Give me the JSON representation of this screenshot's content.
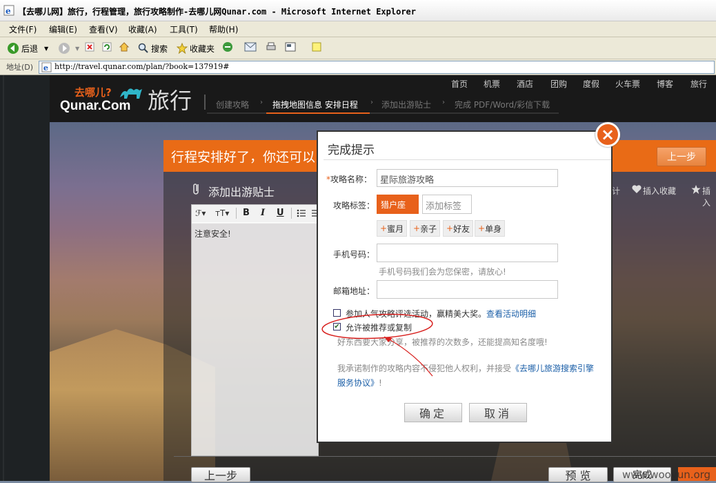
{
  "window": {
    "title": "【去哪儿网】旅行，行程管理，旅行攻略制作-去哪儿网Qunar.com - Microsoft Internet Explorer"
  },
  "menu": [
    "文件(F)",
    "编辑(E)",
    "查看(V)",
    "收藏(A)",
    "工具(T)",
    "帮助(H)"
  ],
  "toolbar": {
    "back": "后退",
    "search": "搜索",
    "favorites": "收藏夹"
  },
  "address": {
    "label": "地址(D)",
    "url": "http://travel.qunar.com/plan/?book=137919#"
  },
  "site": {
    "logo_top": "去哪儿?",
    "logo_bottom": "Qunar.Com",
    "section": "旅行",
    "nav": [
      "首页",
      "机票",
      "酒店",
      "团购",
      "度假",
      "火车票",
      "博客",
      "旅行"
    ],
    "steps": [
      "创建攻略",
      "拖拽地图信息 安排日程",
      "添加出游贴士",
      "完成 PDF/Word/彩信下载"
    ]
  },
  "page": {
    "banner": "行程安排好了，你还可以",
    "prev_top": "上一步",
    "tips_title": "添加出游贴士",
    "action_insert_fav": "插入收藏",
    "action_insert": "插入",
    "editor_text": "注意安全!",
    "bottom_prev": "上一步",
    "bottom_preview": "预 览",
    "bottom_done": "完成",
    "watermark": "www.wooyun.org"
  },
  "dialog": {
    "title": "完成提示",
    "name_label": "攻略名称：",
    "name_value": "星际旅游攻略",
    "tag_label": "攻略标签：",
    "tag_selected": "猎户座",
    "tag_placeholder": "添加标签",
    "suggested_tags": [
      "蜜月",
      "亲子",
      "好友",
      "单身"
    ],
    "phone_label": "手机号码：",
    "phone_hint": "手机号码我们会为您保密，请放心!",
    "email_label": "邮箱地址：",
    "contest_text": "参加人气攻略评选活动，赢精美大奖。",
    "contest_link": "查看活动明细",
    "allow_text": "允许被推荐或复制",
    "allow_hint": "好东西要大家分享，被推荐的次数多，还能提高知名度哦!",
    "promise_text": "我承诺制作的攻略内容不侵犯他人权利，并接受",
    "promise_link": "《去哪儿旅游搜索引擎服务协议》",
    "promise_end": "!",
    "ok_label": "确定",
    "cancel_label": "取消"
  },
  "colors": {
    "accent": "#e8611b",
    "link": "#1b5fa8"
  }
}
